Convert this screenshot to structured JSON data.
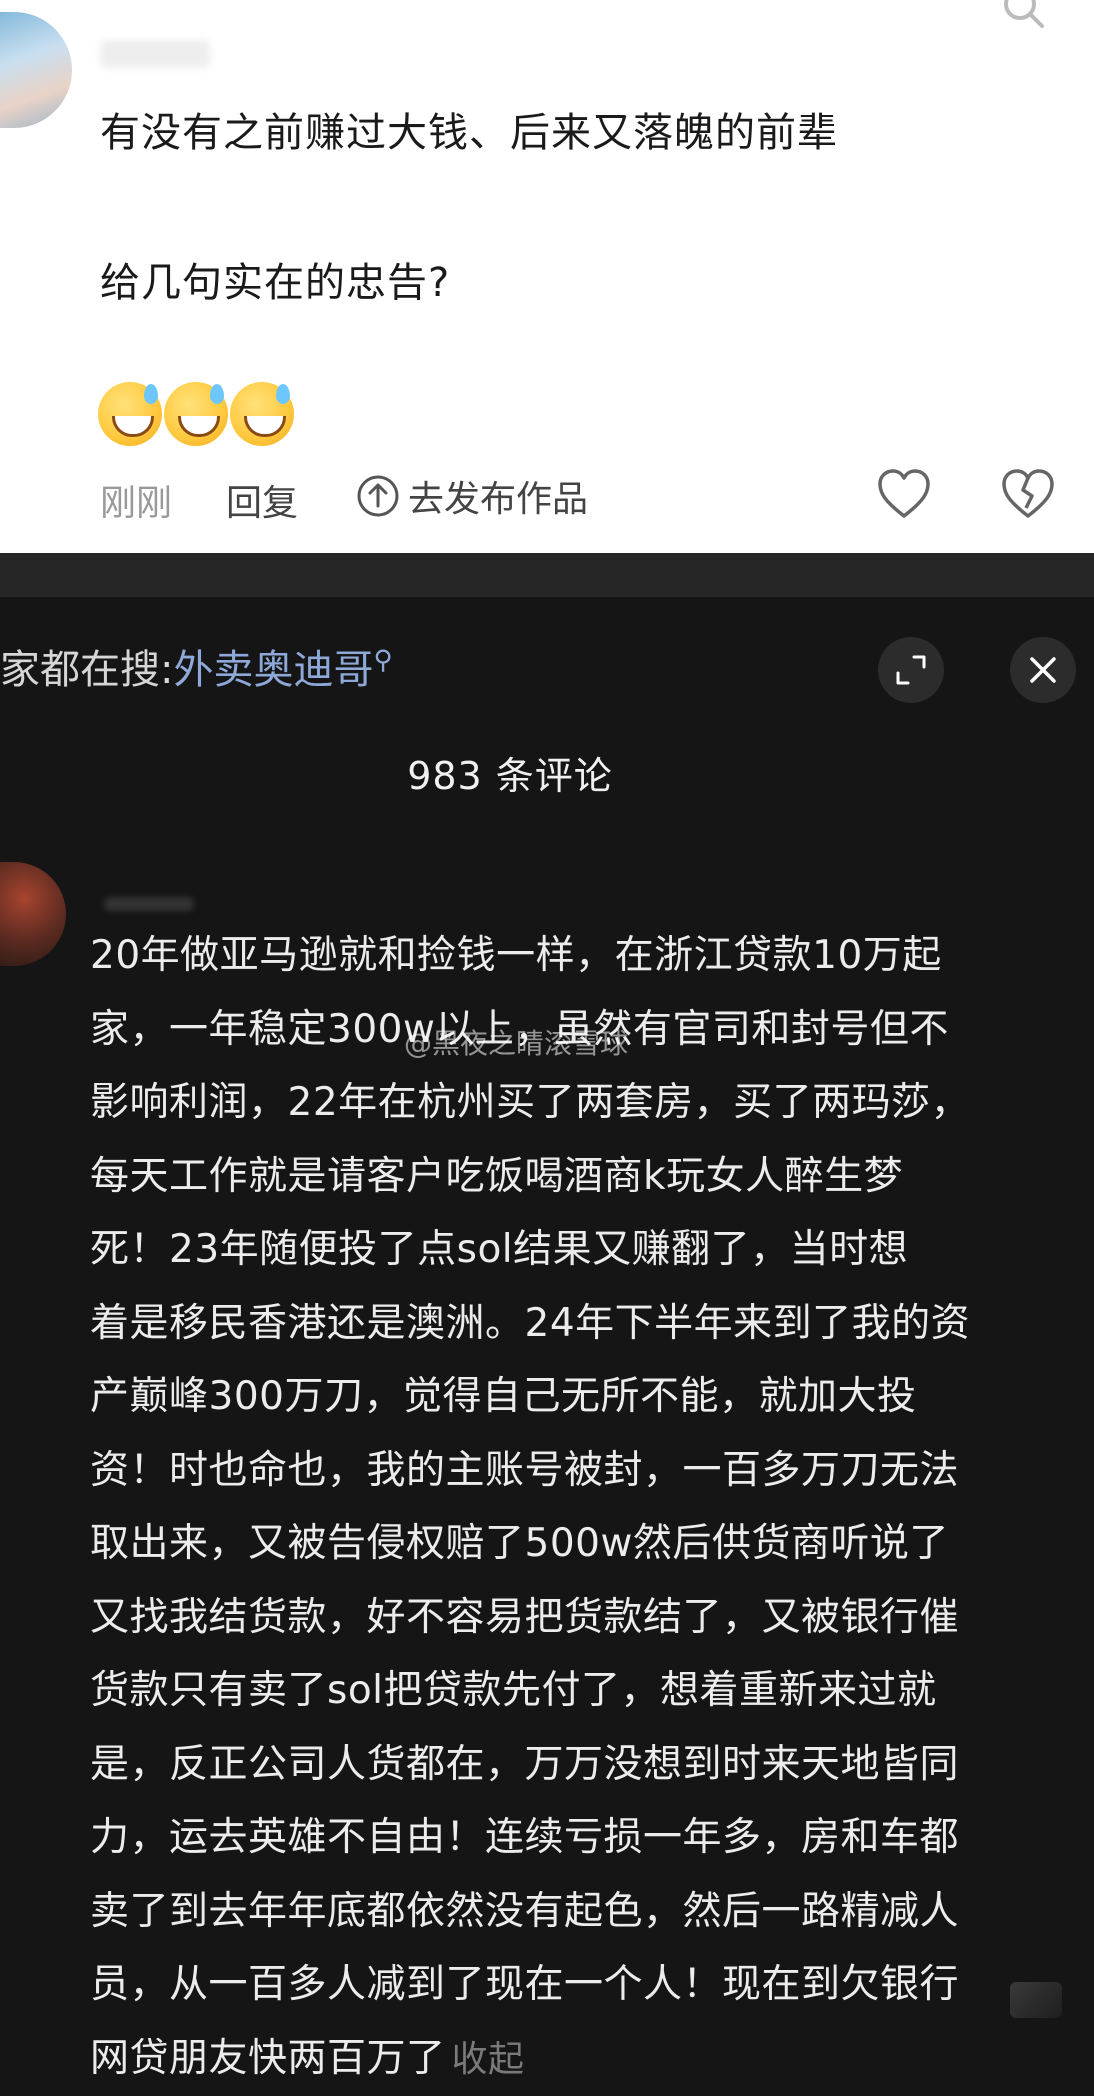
{
  "post": {
    "line1": "有没有之前赚过大钱、后来又落魄的前辈",
    "line2": "给几句实在的忠告?",
    "time": "刚刚",
    "reply_label": "回复",
    "publish_label": "去发布作品"
  },
  "search_bar": {
    "prefix": "家都在搜:",
    "term": "外卖奥迪哥"
  },
  "comments_header": {
    "count_text": "983 条评论"
  },
  "comment": {
    "lines": [
      "20年做亚马逊就和捡钱一样，在浙江贷款10万起",
      "家，一年稳定300w以上，虽然有官司和封号但不",
      "影响利润，22年在杭州买了两套房，买了两玛莎，",
      "每天工作就是请客户吃饭喝酒商k玩女人醉生梦",
      "死！23年随便投了点sol结果又赚翻了，当时想",
      "着是移民香港还是澳洲。24年下半年来到了我的资",
      "产巅峰300万刀，觉得自己无所不能，就加大投",
      "资！时也命也，我的主账号被封，一百多万刀无法",
      "取出来，又被告侵权赔了500w然后供货商听说了",
      "又找我结货款，好不容易把货款结了，又被银行催",
      "货款只有卖了sol把贷款先付了，想着重新来过就",
      "是，反正公司人货都在，万万没想到时来天地皆同",
      "力，运去英雄不自由！连续亏损一年多，房和车都",
      "卖了到去年年底都依然没有起色，然后一路精减人",
      "员，从一百多人减到了现在一个人！现在到欠银行",
      "网贷朋友快两百万了"
    ],
    "collapse_label": "收起",
    "watermark": "@黑夜之睛滚雪球"
  }
}
